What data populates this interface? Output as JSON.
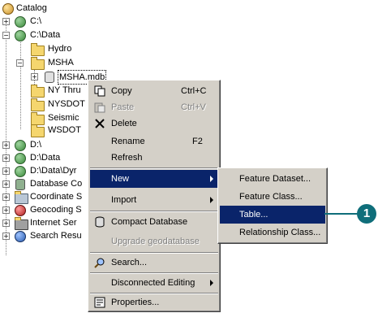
{
  "tree": {
    "catalog": "Catalog",
    "c_drive": "C:\\",
    "c_data": "C:\\Data",
    "hydro": "Hydro",
    "msha": "MSHA",
    "msha_mdb": "MSHA.mdb",
    "ny_thru": "NY Thru",
    "nysdot": "NYSDOT",
    "seismic": "Seismic",
    "wsdot": "WSDOT",
    "d_drive": "D:\\",
    "d_data": "D:\\Data",
    "d_data_dyn": "D:\\Data\\Dyr",
    "database_conn": "Database Co",
    "coordinate": "Coordinate S",
    "geocoding": "Geocoding S",
    "internet": "Internet Ser",
    "search_results": "Search Resu"
  },
  "context_menu": {
    "items": [
      {
        "label": "Copy",
        "shortcut": "Ctrl+C",
        "icon": "copy-icon"
      },
      {
        "label": "Paste",
        "shortcut": "Ctrl+V",
        "icon": "paste-icon"
      },
      {
        "label": "Delete",
        "icon": "delete-icon"
      },
      {
        "label": "Rename",
        "shortcut": "F2"
      },
      {
        "label": "Refresh"
      },
      {
        "label": "New"
      },
      {
        "label": "Import"
      },
      {
        "label": "Compact Database",
        "icon": "compact-database-icon"
      },
      {
        "label": "Upgrade geodatabase"
      },
      {
        "label": "Search...",
        "icon": "search-icon"
      },
      {
        "label": "Disconnected Editing"
      },
      {
        "label": "Properties...",
        "icon": "properties-icon"
      }
    ]
  },
  "submenu": {
    "items": [
      {
        "label": "Feature Dataset..."
      },
      {
        "label": "Feature Class..."
      },
      {
        "label": "Table..."
      },
      {
        "label": "Relationship Class..."
      }
    ]
  },
  "callout": {
    "number": "1",
    "color": "#0f6e7a"
  },
  "colors": {
    "menu_bg": "#d4d0c8",
    "highlight": "#0a246a",
    "highlight_text": "#ffffff"
  }
}
